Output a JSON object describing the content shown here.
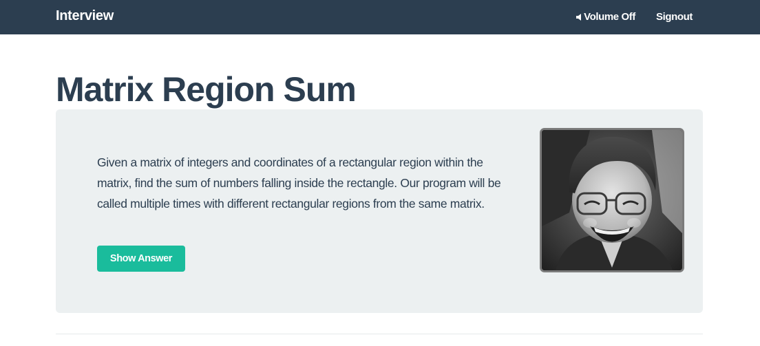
{
  "navbar": {
    "brand": "Interview",
    "volume_label": "Volume Off",
    "signout_label": "Signout"
  },
  "page": {
    "title": "Matrix Region Sum"
  },
  "question": {
    "text": "Given a matrix of integers and coordinates of a rectangular region within the matrix, find the sum of numbers falling inside the rectangle. Our program will be called multiple times with different rectangular regions from the same matrix.",
    "button_label": "Show Answer"
  },
  "icons": {
    "volume": "speaker-icon"
  },
  "colors": {
    "navbar": "#2c3e50",
    "title": "#2c3e50",
    "panel": "#ecf0f1",
    "button": "#1abc9c"
  }
}
